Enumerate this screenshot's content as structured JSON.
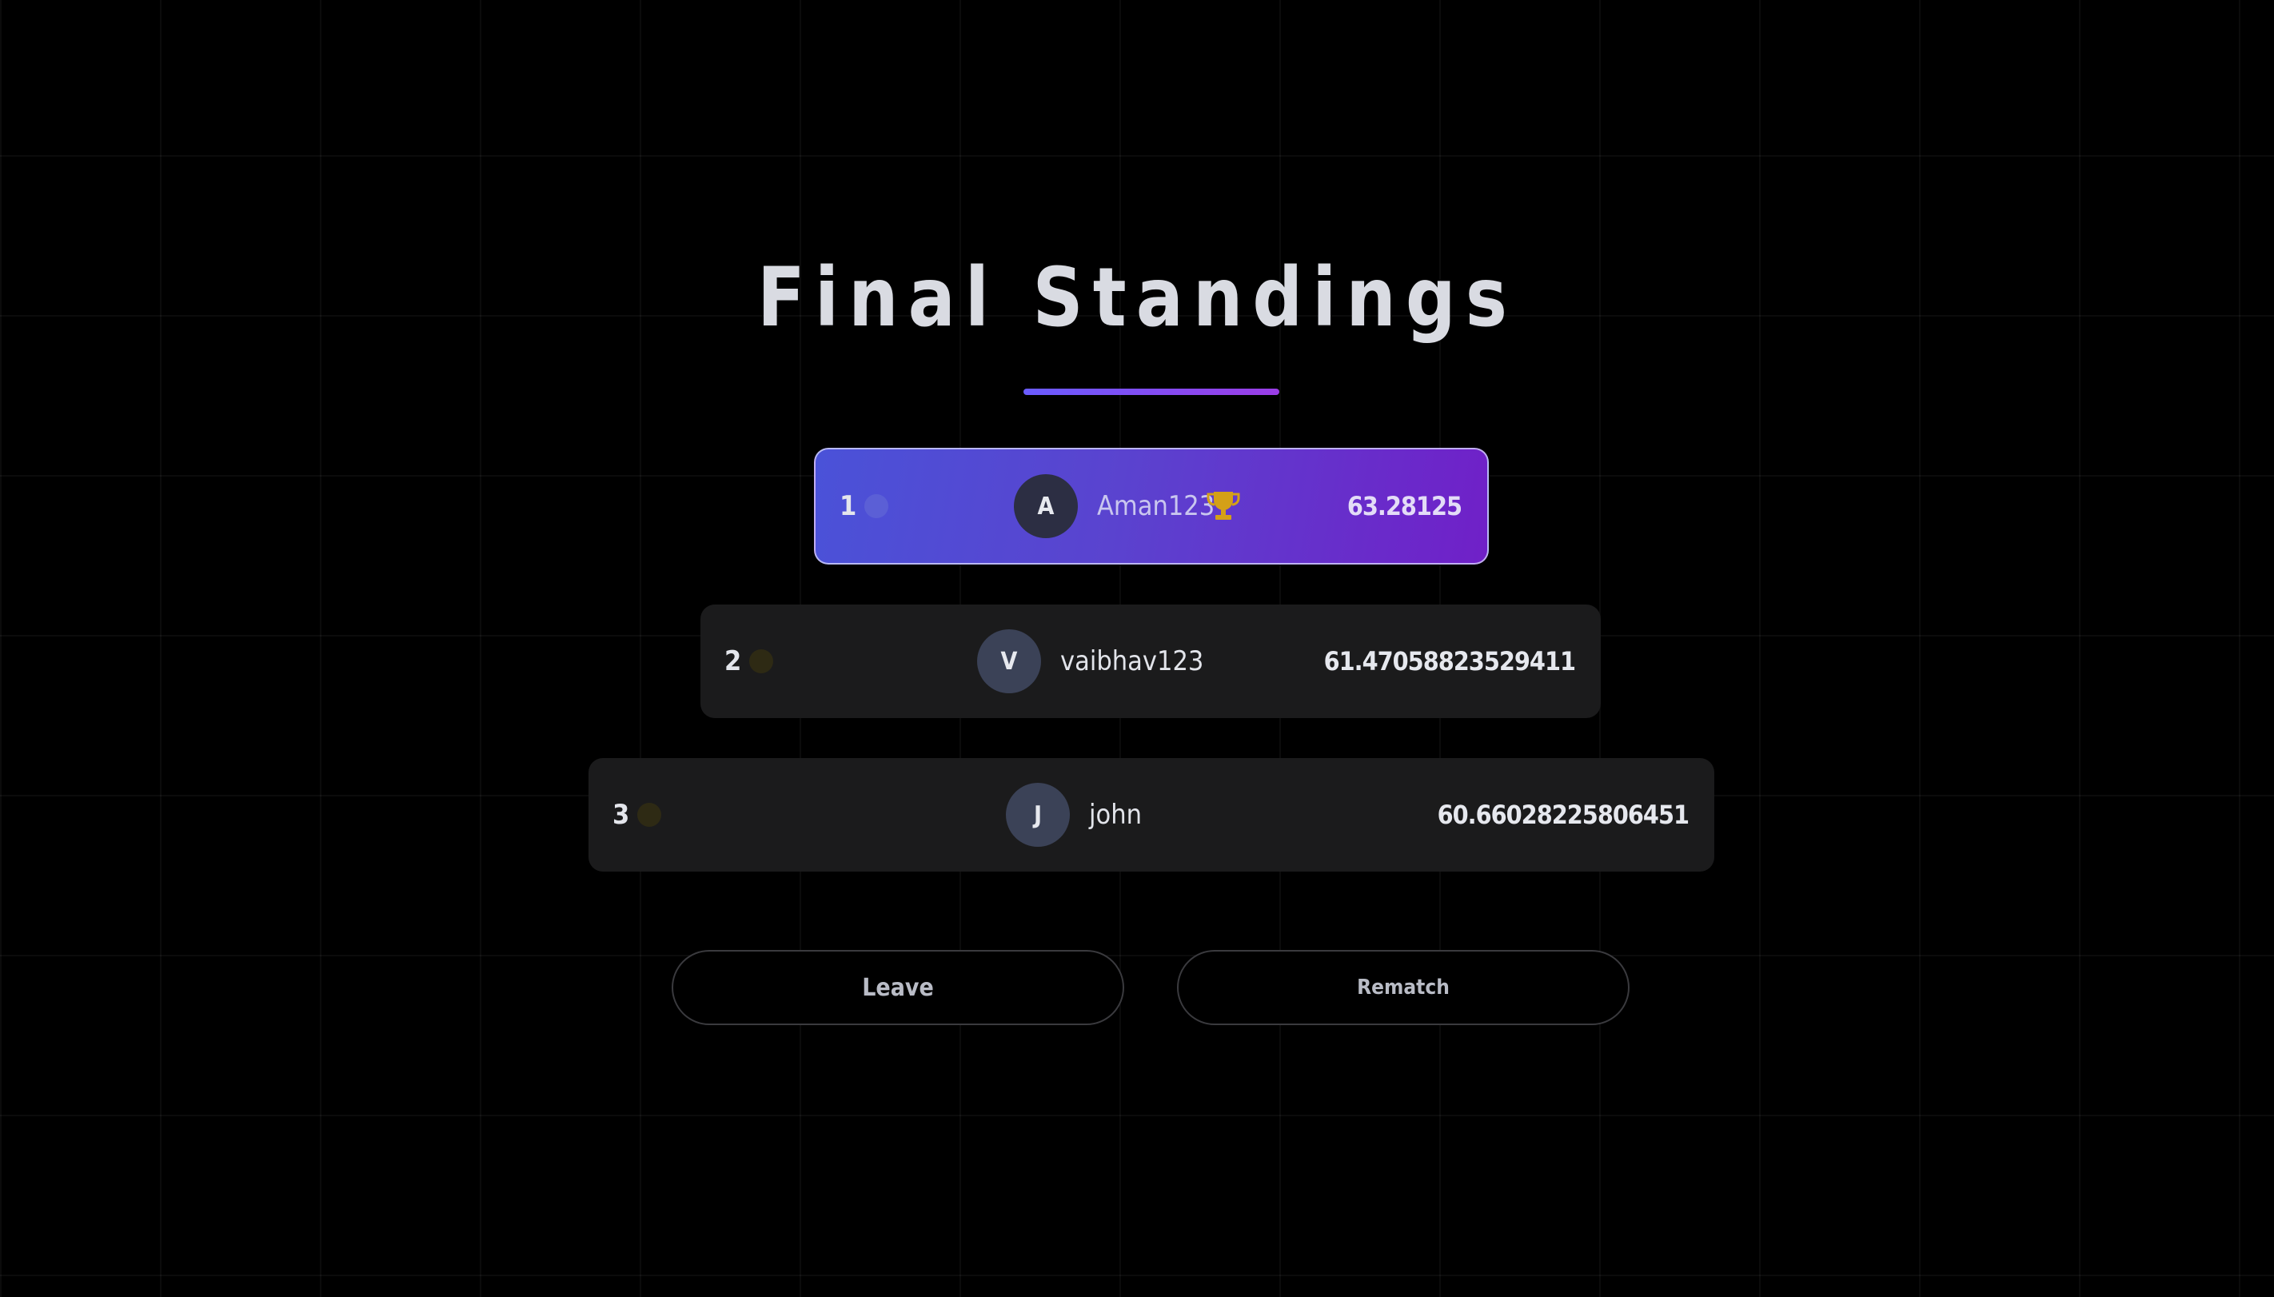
{
  "header": {
    "title": "Final Standings"
  },
  "standings": [
    {
      "rank": "1",
      "initial": "A",
      "name": "Aman123",
      "score": "63.28125",
      "winner": true,
      "trophy_icon": "trophy-icon",
      "dot_color": "#5b5fd6"
    },
    {
      "rank": "2",
      "initial": "V",
      "name": "vaibhav123",
      "score": "61.47058823529411",
      "winner": false,
      "dot_color": "#2e2a14"
    },
    {
      "rank": "3",
      "initial": "J",
      "name": "john",
      "score": "60.66028225806451",
      "winner": false,
      "dot_color": "#2e2a14"
    }
  ],
  "actions": {
    "leave_label": "Leave",
    "rematch_label": "Rematch"
  },
  "colors": {
    "background": "#000000",
    "winner_gradient_start": "#4a52d8",
    "winner_gradient_end": "#7020c8",
    "row_background": "#1b1b1c",
    "trophy": "#d4a017"
  }
}
